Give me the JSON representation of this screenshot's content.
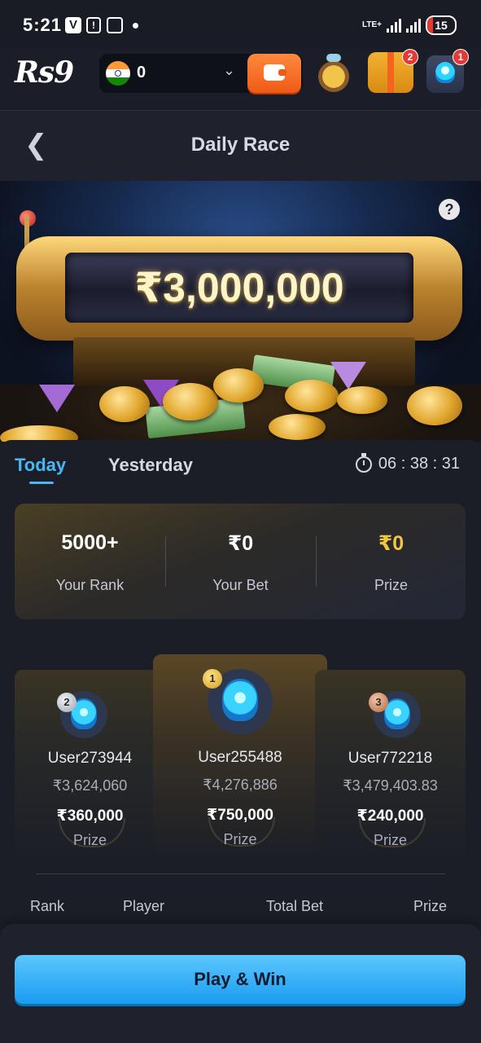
{
  "status_bar": {
    "time": "5:21",
    "network": "LTE+",
    "battery": "15"
  },
  "header": {
    "logo": "Rs9",
    "balance": "0",
    "badges": {
      "gift": "2",
      "support": "1"
    }
  },
  "titlebar": {
    "title": "Daily Race"
  },
  "banner": {
    "prize_pool": "₹3,000,000",
    "help": "?"
  },
  "tabs": {
    "today": "Today",
    "yesterday": "Yesterday",
    "timer": "06 : 38 : 31"
  },
  "stats": [
    {
      "value": "5000+",
      "label": "Your Rank",
      "color": "#ffffff"
    },
    {
      "value": "₹0",
      "label": "Your Bet",
      "color": "#ffffff"
    },
    {
      "value": "₹0",
      "label": "Prize",
      "color": "#f5c542"
    }
  ],
  "podium": {
    "second": {
      "rank": "2",
      "user": "User273944",
      "bet": "₹3,624,060",
      "prize": "₹360,000",
      "prize_label": "Prize"
    },
    "first": {
      "rank": "1",
      "user": "User255488",
      "bet": "₹4,276,886",
      "prize": "₹750,000",
      "prize_label": "Prize"
    },
    "third": {
      "rank": "3",
      "user": "User772218",
      "bet": "₹3,479,403.83",
      "prize": "₹240,000",
      "prize_label": "Prize"
    }
  },
  "table_headers": {
    "rank": "Rank",
    "player": "Player",
    "total_bet": "Total Bet",
    "prize": "Prize"
  },
  "cta": {
    "label": "Play & Win"
  },
  "colors": {
    "accent": "#49b6f5",
    "brand_orange": "#f05a15",
    "gold": "#f5c542",
    "background": "#1a1d26"
  }
}
